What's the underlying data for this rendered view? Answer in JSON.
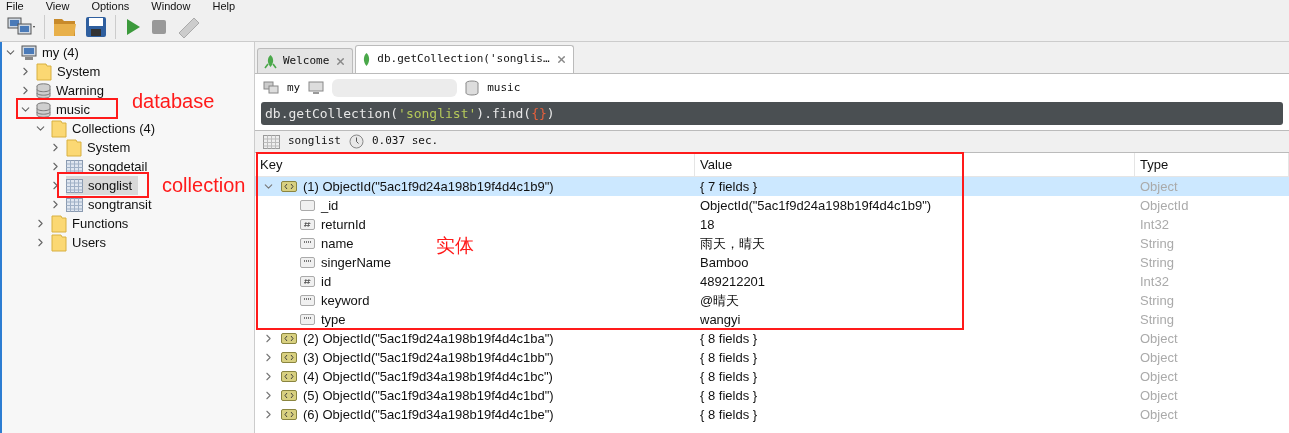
{
  "menu": [
    "File",
    "View",
    "Options",
    "Window",
    "Help"
  ],
  "tree": [
    {
      "label": "my (4)",
      "kind": "server",
      "expanded": true,
      "selected": false,
      "children": [
        {
          "label": "System",
          "kind": "folder",
          "expanded": false,
          "selected": false
        },
        {
          "label": "Warning",
          "kind": "database",
          "expanded": false,
          "selected": false
        },
        {
          "label": "music",
          "kind": "database",
          "expanded": true,
          "selected": false,
          "children": [
            {
              "label": "Collections (4)",
              "kind": "folder",
              "expanded": true,
              "selected": false,
              "children": [
                {
                  "label": "System",
                  "kind": "folder",
                  "expanded": false,
                  "selected": false
                },
                {
                  "label": "songdetail",
                  "kind": "collection",
                  "expanded": false,
                  "selected": false
                },
                {
                  "label": "songlist",
                  "kind": "collection",
                  "expanded": false,
                  "selected": true
                },
                {
                  "label": "songtransit",
                  "kind": "collection",
                  "expanded": false,
                  "selected": false
                }
              ]
            },
            {
              "label": "Functions",
              "kind": "folder",
              "expanded": false,
              "selected": false
            },
            {
              "label": "Users",
              "kind": "folder",
              "expanded": false,
              "selected": false
            }
          ]
        }
      ]
    }
  ],
  "tabs": [
    {
      "label": "Welcome",
      "kind": "welcome",
      "selected": false
    },
    {
      "label": "db.getCollection('songlis…",
      "kind": "query",
      "selected": true
    }
  ],
  "breadcrumb": {
    "server": "my",
    "database": "music"
  },
  "query": [
    {
      "text": "db.getCollection(",
      "kind": "code"
    },
    {
      "text": "'songlist'",
      "kind": "string"
    },
    {
      "text": ").find(",
      "kind": "code"
    },
    {
      "text": "{}",
      "kind": "brace"
    },
    {
      "text": ")",
      "kind": "code"
    }
  ],
  "result": {
    "collection": "songlist",
    "time": "0.037 sec."
  },
  "table": {
    "columns": [
      "Key",
      "Value",
      "Type"
    ],
    "rows": [
      {
        "key": "(1) ObjectId(\"5ac1f9d24a198b19f4d4c1b9\")",
        "value": "{ 7 fields }",
        "type": "Object",
        "expanded": true,
        "selected": true,
        "fields": [
          {
            "kind": "objectid",
            "key": "_id",
            "value": "ObjectId(\"5ac1f9d24a198b19f4d4c1b9\")",
            "type": "ObjectId"
          },
          {
            "kind": "number",
            "key": "returnId",
            "value": "18",
            "type": "Int32"
          },
          {
            "kind": "string",
            "key": "name",
            "value": "雨天，晴天",
            "type": "String"
          },
          {
            "kind": "string",
            "key": "singerName",
            "value": "Bamboo",
            "type": "String"
          },
          {
            "kind": "number",
            "key": "id",
            "value": "489212201",
            "type": "Int32"
          },
          {
            "kind": "string",
            "key": "keyword",
            "value": "@晴天",
            "type": "String"
          },
          {
            "kind": "string",
            "key": "type",
            "value": "wangyi",
            "type": "String"
          }
        ]
      },
      {
        "key": "(2) ObjectId(\"5ac1f9d24a198b19f4d4c1ba\")",
        "value": "{ 8 fields }",
        "type": "Object",
        "expanded": false,
        "selected": false
      },
      {
        "key": "(3) ObjectId(\"5ac1f9d24a198b19f4d4c1bb\")",
        "value": "{ 8 fields }",
        "type": "Object",
        "expanded": false,
        "selected": false
      },
      {
        "key": "(4) ObjectId(\"5ac1f9d34a198b19f4d4c1bc\")",
        "value": "{ 8 fields }",
        "type": "Object",
        "expanded": false,
        "selected": false
      },
      {
        "key": "(5) ObjectId(\"5ac1f9d34a198b19f4d4c1bd\")",
        "value": "{ 8 fields }",
        "type": "Object",
        "expanded": false,
        "selected": false
      },
      {
        "key": "(6) ObjectId(\"5ac1f9d34a198b19f4d4c1be\")",
        "value": "{ 8 fields }",
        "type": "Object",
        "expanded": false,
        "selected": false
      }
    ]
  },
  "annotations": [
    {
      "label": "database"
    },
    {
      "label": "collection"
    },
    {
      "label": "实体"
    }
  ]
}
